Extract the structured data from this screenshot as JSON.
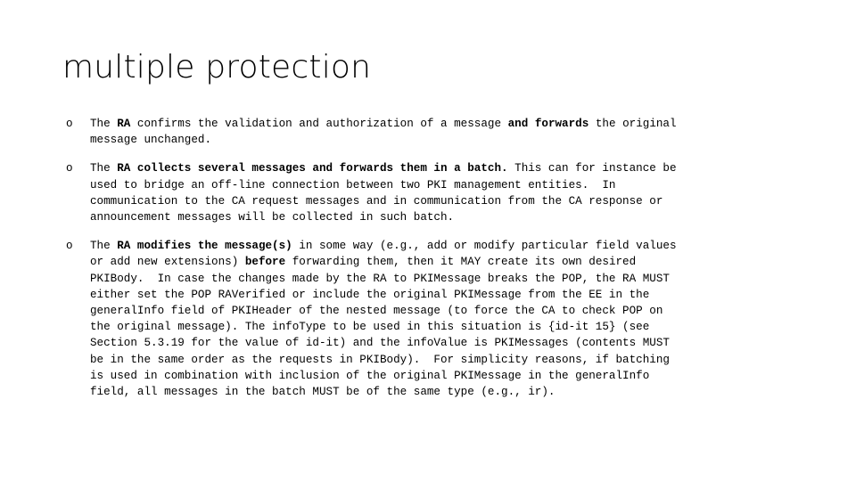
{
  "slide": {
    "title": "multiple protection",
    "bullet_marker": "o",
    "bullets": [
      {
        "id": "bullet-1",
        "runs": [
          {
            "text": "The ",
            "bold": false
          },
          {
            "text": "RA",
            "bold": true
          },
          {
            "text": " confirms the validation and authorization of a message ",
            "bold": false
          },
          {
            "text": "and forwards",
            "bold": true
          },
          {
            "text": " the original\nmessage unchanged.",
            "bold": false
          }
        ],
        "plain": "The RA confirms the validation and authorization of a message and forwards the original message unchanged."
      },
      {
        "id": "bullet-2",
        "runs": [
          {
            "text": "The ",
            "bold": false
          },
          {
            "text": "RA collects several messages and forwards them in a batch.",
            "bold": true
          },
          {
            "text": " This can for instance be\nused to bridge an off-line connection between two PKI management entities.  In\ncommunication to the CA request messages and in communication from the CA response or\nannouncement messages will be collected in such batch.",
            "bold": false
          }
        ],
        "plain": "The RA collects several messages and forwards them in a batch. This can for instance be used to bridge an off-line connection between two PKI management entities.  In communication to the CA request messages and in communication from the CA response or announcement messages will be collected in such batch."
      },
      {
        "id": "bullet-3",
        "runs": [
          {
            "text": "The ",
            "bold": false
          },
          {
            "text": "RA modifies the message(s)",
            "bold": true
          },
          {
            "text": " in some way (e.g., add or modify particular field values\nor add new extensions) ",
            "bold": false
          },
          {
            "text": "before",
            "bold": true
          },
          {
            "text": " forwarding them, then it MAY create its own desired\nPKIBody.  In case the changes made by the RA to PKIMessage breaks the POP, the RA MUST\neither set the POP RAVerified or include the original PKIMessage from the EE in the\ngeneralInfo field of PKIHeader of the nested message (to force the CA to check POP on\nthe original message). The infoType to be used in this situation is {id-it 15} (see\nSection 5.3.19 for the value of id-it) and the infoValue is PKIMessages (contents MUST\nbe in the same order as the requests in PKIBody).  For simplicity reasons, if batching\nis used in combination with inclusion of the original PKIMessage in the generalInfo\nfield, all messages in the batch MUST be of the same type (e.g., ir).",
            "bold": false
          }
        ],
        "plain": "The RA modifies the message(s) in some way (e.g., add or modify particular field values or add new extensions) before forwarding them, then it MAY create its own desired PKIBody.  In case the changes made by the RA to PKIMessage breaks the POP, the RA MUST either set the POP RAVerified or include the original PKIMessage from the EE in the generalInfo field of PKIHeader of the nested message (to force the CA to check POP on the original message). The infoType to be used in this situation is {id-it 15} (see Section 5.3.19 for the value of id-it) and the infoValue is PKIMessages (contents MUST be in the same order as the requests in PKIBody).  For simplicity reasons, if batching is used in combination with inclusion of the original PKIMessage in the generalInfo field, all messages in the batch MUST be of the same type (e.g., ir)."
      }
    ],
    "colors": {
      "background": "#ffffff",
      "text": "#000000"
    }
  }
}
